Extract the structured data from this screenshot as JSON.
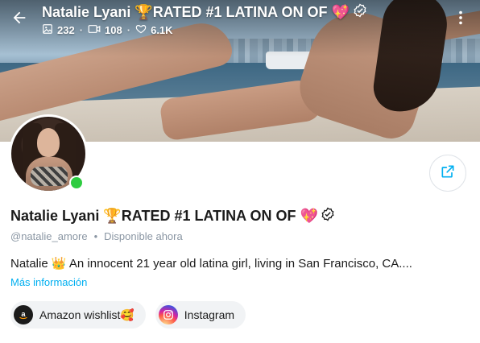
{
  "cover": {
    "title": "Natalie Lyani 🏆RATED #1 LATINA ON OF 💖",
    "stats": {
      "photos": "232",
      "videos": "108",
      "likes": "6.1K"
    }
  },
  "profile": {
    "name": "Natalie Lyani 🏆RATED #1 LATINA ON OF 💖",
    "handle": "@natalie_amore",
    "separator": "•",
    "status": "Disponible ahora",
    "bio": "Natalie 👑 An innocent 21 year old latina girl, living in San Francisco, CA....",
    "more_info": "Más información"
  },
  "links": [
    {
      "label": "Amazon wishlist🥰",
      "icon": "amazon-icon"
    },
    {
      "label": "Instagram",
      "icon": "instagram-icon"
    }
  ],
  "colors": {
    "accent": "#00aff0",
    "online": "#2ecc40",
    "muted_text": "#8a96a3"
  }
}
